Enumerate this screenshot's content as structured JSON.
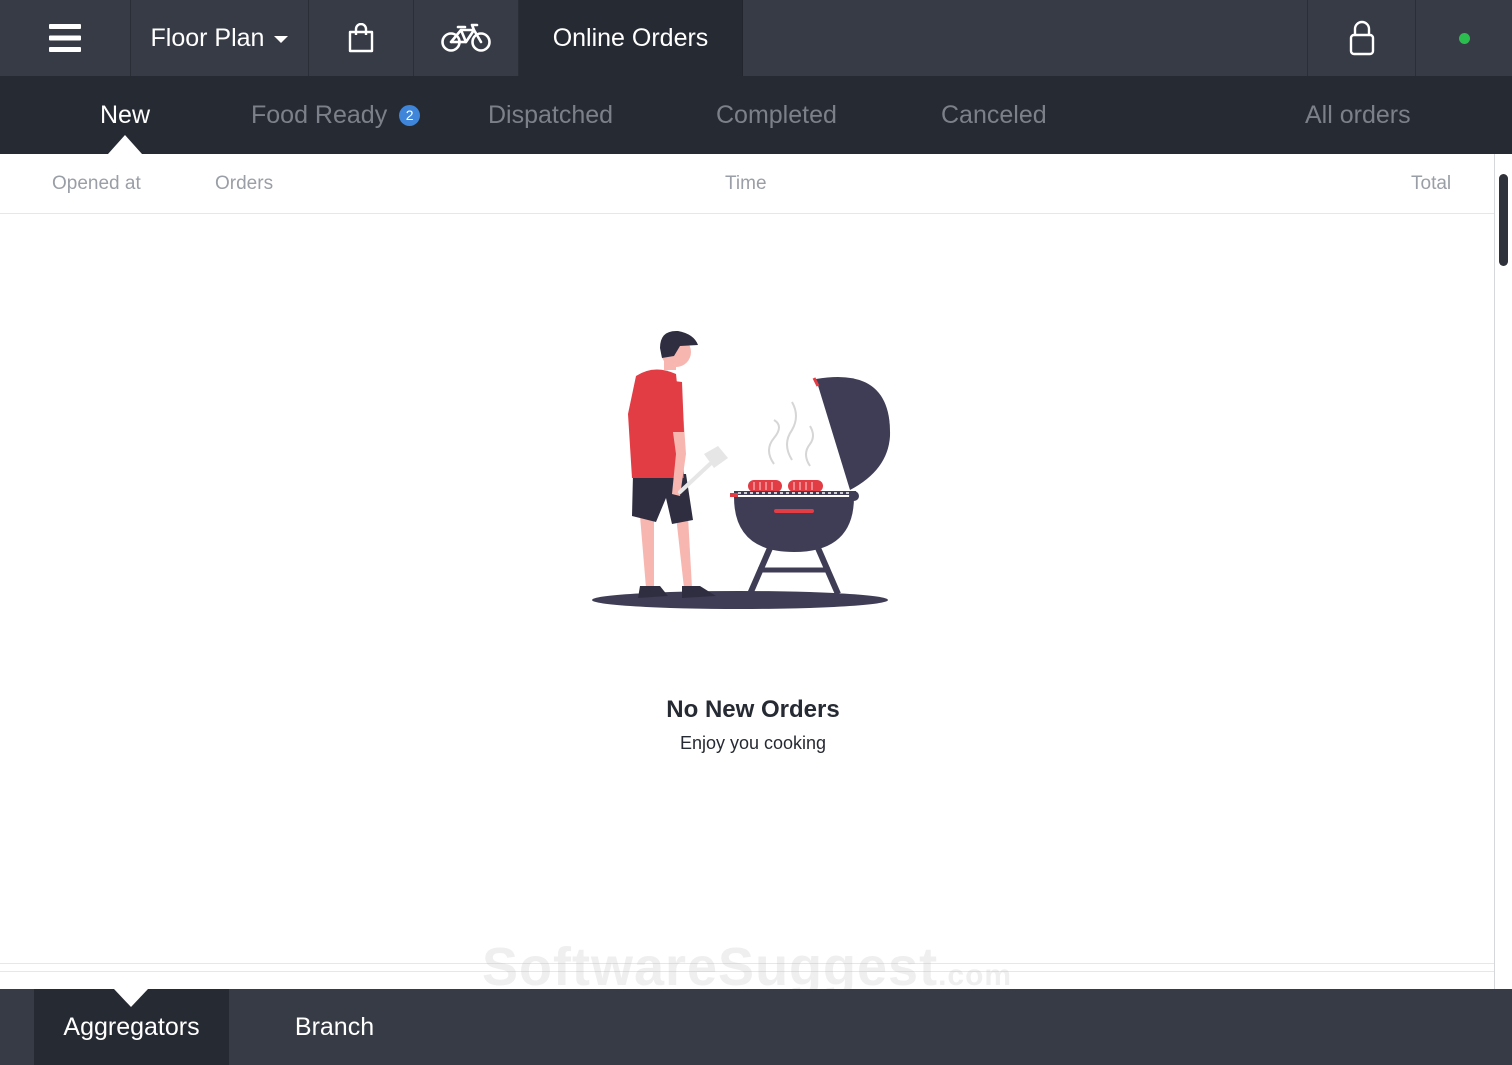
{
  "topbar": {
    "menu_icon": "hamburger-icon",
    "floor_plan_label": "Floor Plan",
    "bag_icon": "shopping-bag-icon",
    "bike_icon": "bicycle-icon",
    "online_orders_label": "Online Orders",
    "lock_icon": "lock-icon",
    "status_color": "#2bbd4e"
  },
  "tabs": [
    {
      "label": "New",
      "active": true
    },
    {
      "label": "Food Ready",
      "badge": "2"
    },
    {
      "label": "Dispatched"
    },
    {
      "label": "Completed"
    },
    {
      "label": "Canceled"
    },
    {
      "label": "All orders"
    }
  ],
  "columns": [
    "Opened at",
    "Orders",
    "Time",
    "Total"
  ],
  "empty_state": {
    "illustration": "person-grilling-illustration",
    "title": "No New Orders",
    "subtitle": "Enjoy you cooking"
  },
  "watermark": {
    "text": "SoftwareSuggest",
    "suffix": ".com"
  },
  "bottom_tabs": [
    {
      "label": "Aggregators",
      "active": true
    },
    {
      "label": "Branch"
    }
  ],
  "colors": {
    "topbar_bg": "#363b46",
    "tabbar_bg": "#262a33",
    "badge_blue": "#3f85d9",
    "accent_red": "#e23c44"
  }
}
